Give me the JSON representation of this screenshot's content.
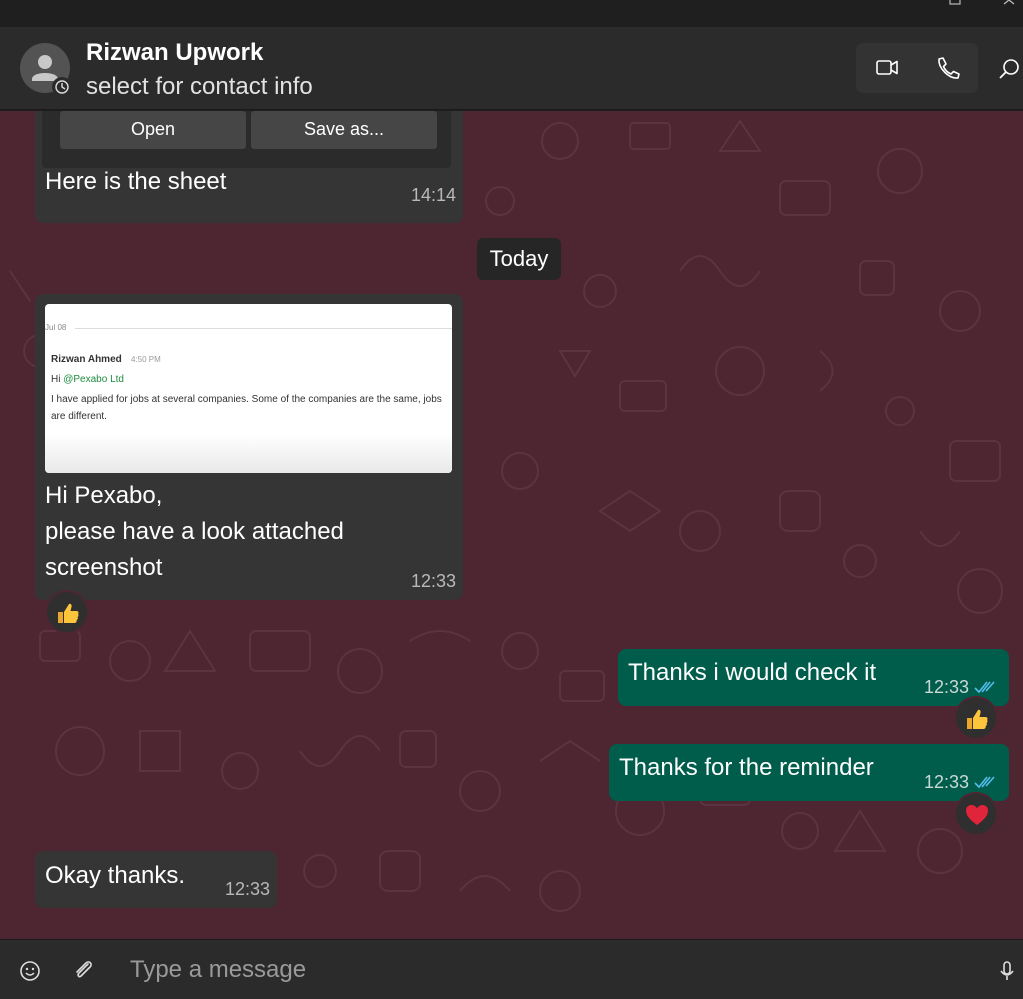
{
  "header": {
    "contact_name": "Rizwan Upwork",
    "contact_sub": "select for contact info",
    "icons": [
      "video-call-icon",
      "voice-call-icon",
      "search-icon"
    ]
  },
  "file_message": {
    "open_label": "Open",
    "save_label": "Save as...",
    "text": "Here is the sheet",
    "time": "14:14"
  },
  "date_separator": "Today",
  "screenshot_message": {
    "shot": {
      "date": "Jul 08",
      "author": "Rizwan Ahmed",
      "author_time": "4:50 PM",
      "greeting": "Hi ",
      "mention": "@Pexabo Ltd",
      "body": "I have applied for jobs at several companies. Some of the companies are the same, jobs are different."
    },
    "text": "Hi Pexabo,\nplease have a look attached\nscreenshot",
    "time": "12:33",
    "reaction": "thumbs-up"
  },
  "outgoing": [
    {
      "text": "Thanks i would check it",
      "time": "12:33",
      "status": "read",
      "reaction": "thumbs-up"
    },
    {
      "text": "Thanks for the reminder",
      "time": "12:33",
      "status": "read",
      "reaction": "red-heart"
    }
  ],
  "last_incoming": {
    "text": "Okay thanks.",
    "time": "12:33"
  },
  "composer": {
    "placeholder": "Type a message"
  },
  "colors": {
    "chat_bg": "#4d2631",
    "incoming_bubble": "#353535",
    "outgoing_bubble": "#005c4b",
    "read_tick": "#53bdeb"
  }
}
